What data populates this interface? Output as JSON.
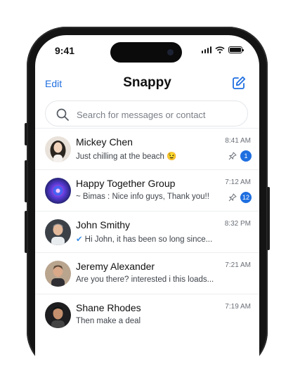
{
  "status_bar": {
    "time": "9:41"
  },
  "header": {
    "edit_label": "Edit",
    "title": "Snappy"
  },
  "search": {
    "placeholder": "Search for messages or contact"
  },
  "colors": {
    "accent": "#1f6fe0",
    "badge": "#1f6fe0"
  },
  "chats": [
    {
      "name": "Mickey Chen",
      "preview": "Just chilling at the beach 😉",
      "time": "8:41 AM",
      "pinned": true,
      "unread": "1"
    },
    {
      "name": "Happy Together Group",
      "preview": "~ Bimas : Nice info guys, Thank you!!",
      "time": "7:12 AM",
      "pinned": true,
      "unread": "12"
    },
    {
      "name": "John Smithy",
      "preview": "Hi John, it has been so long since...",
      "time": "8:32 PM",
      "read_receipt": "✔"
    },
    {
      "name": "Jeremy Alexander",
      "preview": "Are you there?  interested i this loads...",
      "time": "7:21 AM"
    },
    {
      "name": "Shane Rhodes",
      "preview": "Then make a deal",
      "time": "7:19 AM"
    }
  ]
}
